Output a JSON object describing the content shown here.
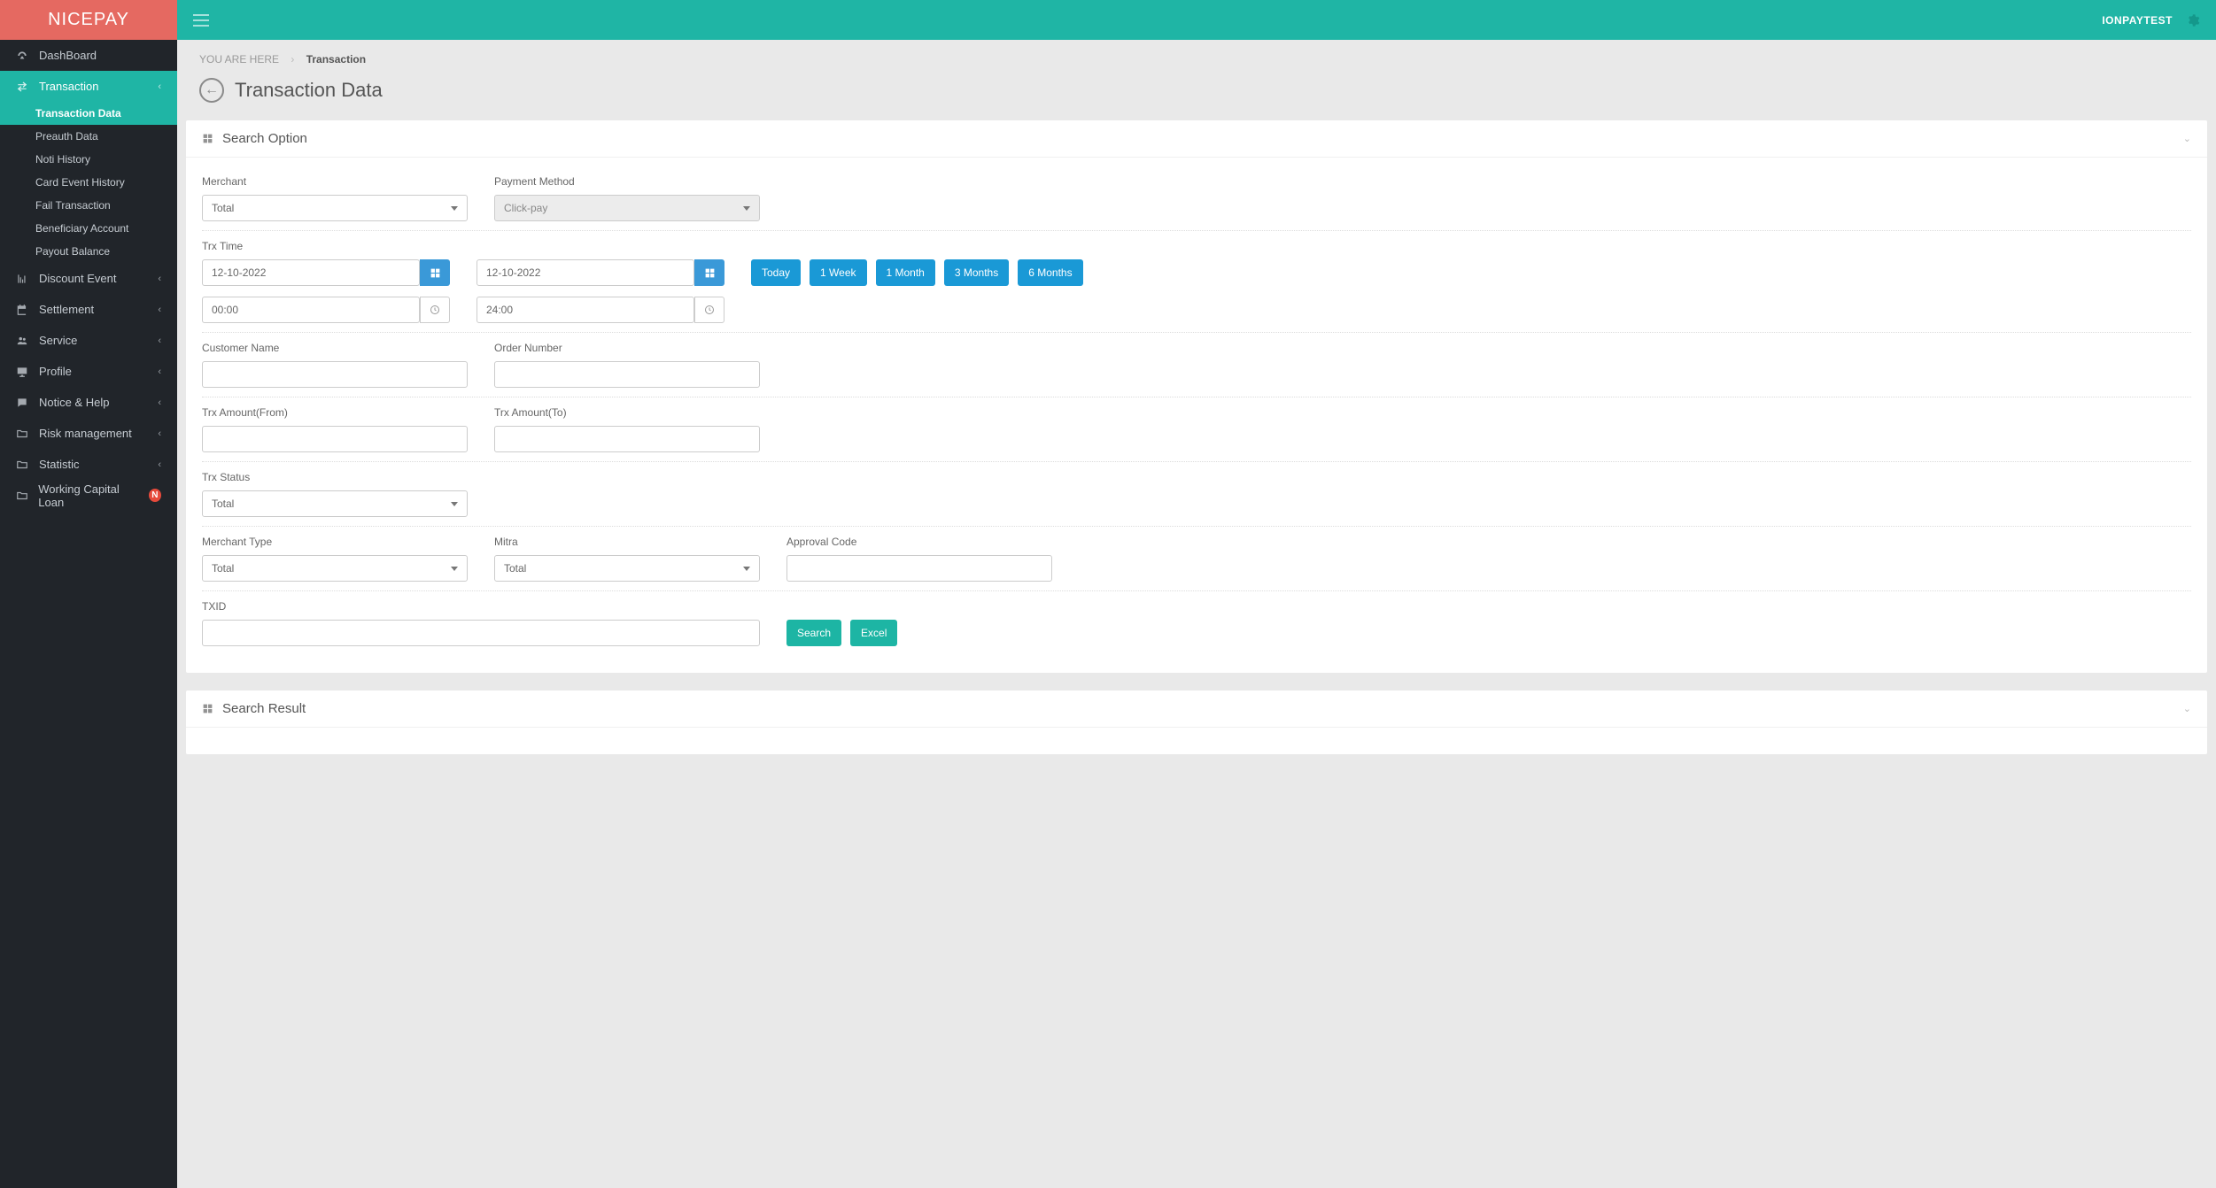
{
  "brand": "NICEPAY",
  "user": "IONPAYTEST",
  "breadcrumb": {
    "youAreHere": "YOU ARE HERE",
    "current": "Transaction"
  },
  "pageTitle": "Transaction Data",
  "sidebar": {
    "items": [
      {
        "label": "DashBoard"
      },
      {
        "label": "Transaction"
      },
      {
        "label": "Discount Event"
      },
      {
        "label": "Settlement"
      },
      {
        "label": "Service"
      },
      {
        "label": "Profile"
      },
      {
        "label": "Notice & Help"
      },
      {
        "label": "Risk management"
      },
      {
        "label": "Statistic"
      },
      {
        "label": "Working Capital Loan"
      }
    ],
    "transactionSub": [
      {
        "label": "Transaction Data"
      },
      {
        "label": "Preauth Data"
      },
      {
        "label": "Noti History"
      },
      {
        "label": "Card Event History"
      },
      {
        "label": "Fail Transaction"
      },
      {
        "label": "Beneficiary Account"
      },
      {
        "label": "Payout Balance"
      }
    ],
    "badge_n": "N"
  },
  "panels": {
    "searchOption": {
      "title": "Search Option",
      "fields": {
        "merchant_label": "Merchant",
        "merchant_value": "Total",
        "paymentMethod_label": "Payment Method",
        "paymentMethod_value": "Click-pay",
        "trxTime_label": "Trx Time",
        "date_from": "12-10-2022",
        "date_to": "12-10-2022",
        "time_from": "00:00",
        "time_to": "24:00",
        "customerName_label": "Customer Name",
        "orderNumber_label": "Order Number",
        "trxAmountFrom_label": "Trx Amount(From)",
        "trxAmountTo_label": "Trx Amount(To)",
        "trxStatus_label": "Trx Status",
        "trxStatus_value": "Total",
        "merchantType_label": "Merchant Type",
        "merchantType_value": "Total",
        "mitra_label": "Mitra",
        "mitra_value": "Total",
        "approvalCode_label": "Approval Code",
        "txid_label": "TXID"
      },
      "quick": {
        "today": "Today",
        "week": "1 Week",
        "month": "1 Month",
        "months3": "3 Months",
        "months6": "6 Months"
      },
      "buttons": {
        "search": "Search",
        "excel": "Excel"
      }
    },
    "searchResult": {
      "title": "Search Result"
    }
  }
}
